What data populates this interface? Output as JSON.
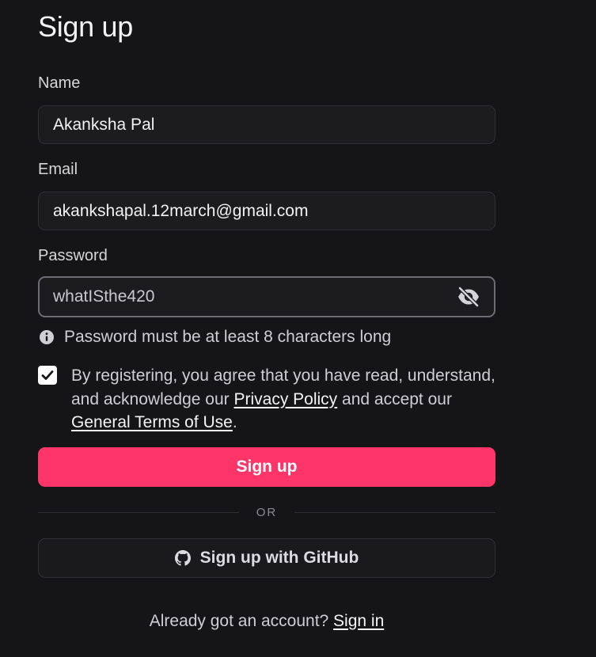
{
  "form": {
    "title": "Sign up",
    "name": {
      "label": "Name",
      "value": "Akanksha Pal"
    },
    "email": {
      "label": "Email",
      "value": "akankshapal.12march@gmail.com"
    },
    "password": {
      "label": "Password",
      "value": "whatISthe420",
      "visibility_icon": "eye-off-icon"
    },
    "password_hint": "Password must be at least 8 characters long",
    "agreement": {
      "checked": true,
      "text_before": "By registering, you agree that you have read, understand, and acknowledge our ",
      "privacy_link": "Privacy Policy",
      "text_middle": " and accept our ",
      "terms_link": "General Terms of Use",
      "text_after": "."
    },
    "submit_label": "Sign up",
    "divider_label": "OR",
    "github_label": "Sign up with GitHub",
    "signin_prompt": "Already got an account? ",
    "signin_link": "Sign in"
  },
  "colors": {
    "background": "#151517",
    "primary": "#fe3569",
    "field_bg": "#1c1c1f"
  }
}
